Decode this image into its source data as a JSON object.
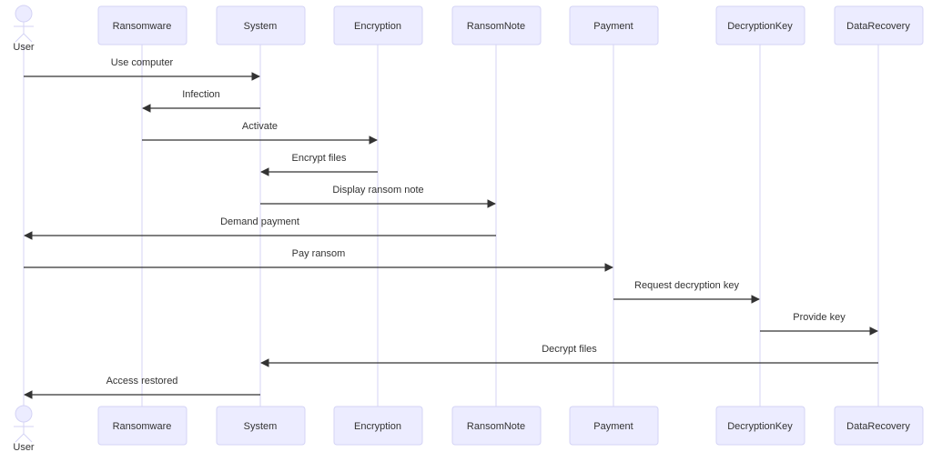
{
  "diagram": {
    "type": "sequence",
    "colors": {
      "actor_fill": "#ECECFF",
      "actor_stroke": "#D4D3F5",
      "lifeline": "#D4D3F5",
      "message": "#333333"
    },
    "participants": [
      {
        "id": "User",
        "label": "User",
        "kind": "actor"
      },
      {
        "id": "Ransomware",
        "label": "Ransomware",
        "kind": "participant"
      },
      {
        "id": "System",
        "label": "System",
        "kind": "participant"
      },
      {
        "id": "Encryption",
        "label": "Encryption",
        "kind": "participant"
      },
      {
        "id": "RansomNote",
        "label": "RansomNote",
        "kind": "participant"
      },
      {
        "id": "Payment",
        "label": "Payment",
        "kind": "participant"
      },
      {
        "id": "DecryptionKey",
        "label": "DecryptionKey",
        "kind": "participant"
      },
      {
        "id": "DataRecovery",
        "label": "DataRecovery",
        "kind": "participant"
      }
    ],
    "messages": [
      {
        "from": "User",
        "to": "System",
        "label": "Use computer"
      },
      {
        "from": "System",
        "to": "Ransomware",
        "label": "Infection"
      },
      {
        "from": "Ransomware",
        "to": "Encryption",
        "label": "Activate"
      },
      {
        "from": "Encryption",
        "to": "System",
        "label": "Encrypt files"
      },
      {
        "from": "System",
        "to": "RansomNote",
        "label": "Display ransom note"
      },
      {
        "from": "RansomNote",
        "to": "User",
        "label": "Demand payment"
      },
      {
        "from": "User",
        "to": "Payment",
        "label": "Pay ransom"
      },
      {
        "from": "Payment",
        "to": "DecryptionKey",
        "label": "Request decryption key"
      },
      {
        "from": "DecryptionKey",
        "to": "DataRecovery",
        "label": "Provide key"
      },
      {
        "from": "DataRecovery",
        "to": "System",
        "label": "Decrypt files"
      },
      {
        "from": "System",
        "to": "User",
        "label": "Access restored"
      }
    ]
  }
}
